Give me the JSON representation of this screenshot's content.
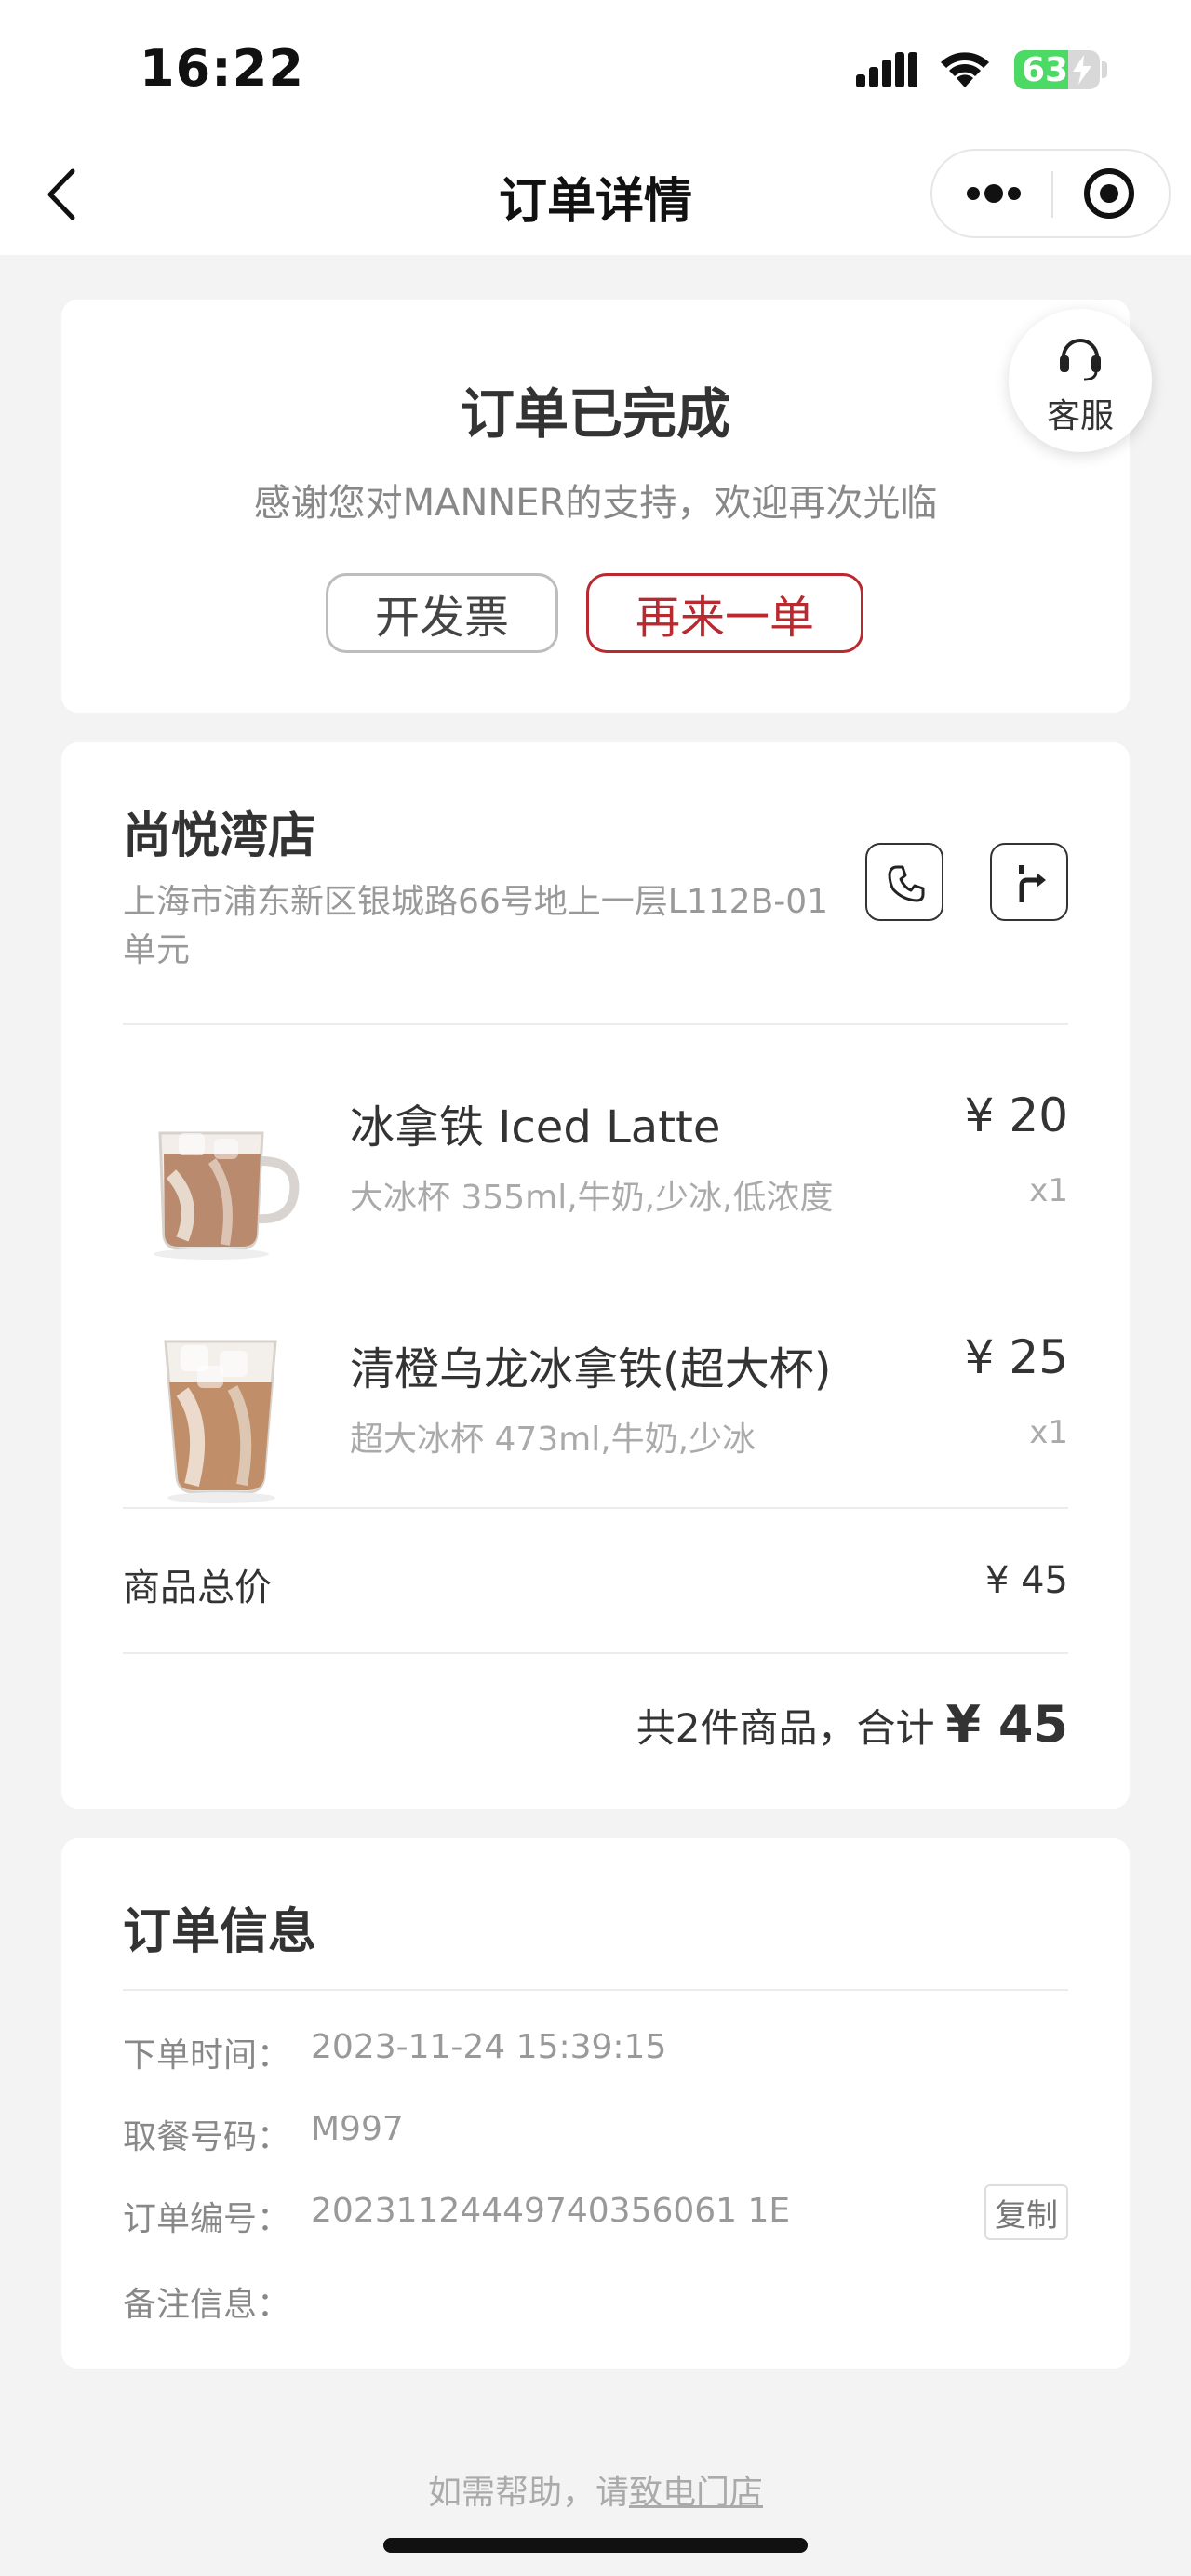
{
  "status_bar": {
    "time": "16:22",
    "battery_level": "63",
    "battery_fraction": 0.63
  },
  "nav": {
    "title": "订单详情",
    "back_icon": "chevron-left-icon",
    "more_icon": "more-dots-icon",
    "close_icon": "target-close-icon"
  },
  "order_status": {
    "title": "订单已完成",
    "subtitle": "感谢您对MANNER的支持，欢迎再次光临",
    "invoice_button": "开发票",
    "reorder_button": "再来一单",
    "accent_color": "#b82a2f"
  },
  "service": {
    "label": "客服",
    "icon": "headset-icon"
  },
  "store": {
    "name": "尚悦湾店",
    "address": "上海市浦东新区银城路66号地上一层L112B-01单元",
    "phone_icon": "phone-icon",
    "navigate_icon": "navigate-arrow-icon"
  },
  "items": [
    {
      "name": "冰拿铁 Iced Latte",
      "specs": "大冰杯 355ml,牛奶,少冰,低浓度",
      "price": "¥ 20",
      "quantity": "x1",
      "image": "iced-latte-mug"
    },
    {
      "name": "清橙乌龙冰拿铁(超大杯)",
      "specs": "超大冰杯 473ml,牛奶,少冰",
      "price": "¥ 25",
      "quantity": "x1",
      "image": "iced-oolong-latte-glass"
    }
  ],
  "totals": {
    "label": "商品总价",
    "value": "¥ 45",
    "summary_prefix": "共2件商品，合计",
    "summary_amount": "¥ 45"
  },
  "order_info": {
    "title": "订单信息",
    "rows": [
      {
        "label": "下单时间：",
        "value": "2023-11-24 15:39:15"
      },
      {
        "label": "取餐号码：",
        "value": "M997"
      },
      {
        "label": "订单编号：",
        "value": "20231124449740356061 1E"
      },
      {
        "label": "备注信息：",
        "value": ""
      }
    ],
    "copy_button": "复制"
  },
  "footer": {
    "help_prefix": "如需帮助，请",
    "help_link": "致电门店"
  }
}
